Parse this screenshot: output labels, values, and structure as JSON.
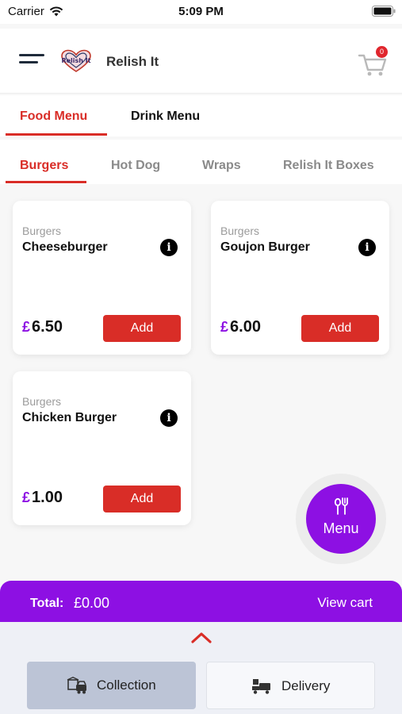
{
  "status_bar": {
    "carrier": "Carrier",
    "time": "5:09 PM"
  },
  "header": {
    "title": "Relish It",
    "logo_text": "Relish It",
    "cart_count": "0"
  },
  "menu_tabs": [
    {
      "label": "Food Menu",
      "active": true
    },
    {
      "label": "Drink Menu",
      "active": false
    }
  ],
  "category_tabs": [
    {
      "label": "Burgers",
      "active": true
    },
    {
      "label": "Hot Dog",
      "active": false
    },
    {
      "label": "Wraps",
      "active": false
    },
    {
      "label": "Relish It Boxes",
      "active": false
    }
  ],
  "products": [
    {
      "category": "Burgers",
      "name": "Cheeseburger",
      "currency": "£",
      "price": "6.50",
      "add_label": "Add",
      "info": "i"
    },
    {
      "category": "Burgers",
      "name": "Goujon Burger",
      "currency": "£",
      "price": "6.00",
      "add_label": "Add",
      "info": "i"
    },
    {
      "category": "Burgers",
      "name": "Chicken Burger",
      "currency": "£",
      "price": "1.00",
      "add_label": "Add",
      "info": "i"
    }
  ],
  "fab": {
    "label": "Menu"
  },
  "cart_bar": {
    "total_label": "Total:",
    "total_value": "£0.00",
    "view_cart_label": "View cart"
  },
  "order_options": [
    {
      "label": "Collection",
      "selected": true
    },
    {
      "label": "Delivery",
      "selected": false
    }
  ],
  "colors": {
    "accent_red": "#d92d27",
    "brand_purple": "#8d10e3"
  }
}
